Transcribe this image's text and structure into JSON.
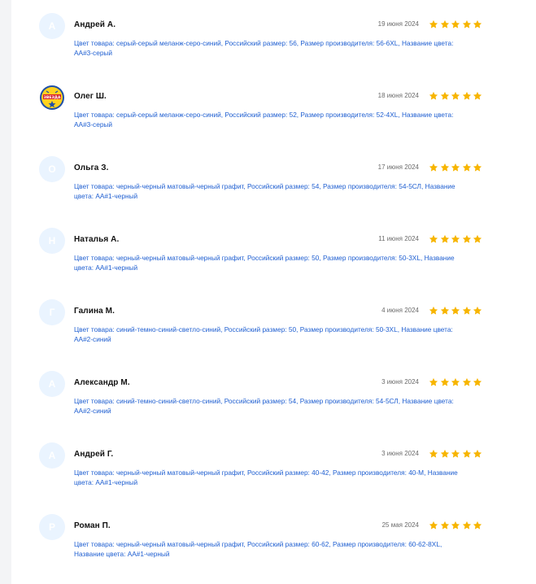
{
  "colors": {
    "star": "#f7b500",
    "details_text": "#1f5fd1",
    "avatar_bg": "#eaf4ff"
  },
  "reviews": [
    {
      "initial": "А",
      "avatar_type": "initial",
      "name": "Андрей А.",
      "date": "19 июня 2024",
      "rating": 5,
      "details": "Цвет товара: серый-серый меланж-серо-синий, Российский размер: 56, Размер производителя: 56-6XL, Название цвета: АА#3-серый"
    },
    {
      "initial": "",
      "avatar_type": "photo",
      "avatar_icon": "team-logo-icon",
      "avatar_text": "ЗВЕЗДА",
      "name": "Олег Ш.",
      "date": "18 июня 2024",
      "rating": 5,
      "details": "Цвет товара: серый-серый меланж-серо-синий, Российский размер: 52, Размер производителя: 52-4XL, Название цвета: АА#3-серый"
    },
    {
      "initial": "О",
      "avatar_type": "initial",
      "name": "Ольга З.",
      "date": "17 июня 2024",
      "rating": 5,
      "details": "Цвет товара: черный-черный матовый-черный графит, Российский размер: 54, Размер производителя: 54-5СЛ, Название цвета: АА#1-черный"
    },
    {
      "initial": "Н",
      "avatar_type": "initial",
      "name": "Наталья А.",
      "date": "11 июня 2024",
      "rating": 5,
      "details": "Цвет товара: черный-черный матовый-черный графит, Российский размер: 50, Размер производителя: 50-3XL, Название цвета: АА#1-черный"
    },
    {
      "initial": "Г",
      "avatar_type": "initial",
      "name": "Галина М.",
      "date": "4 июня 2024",
      "rating": 5,
      "details": "Цвет товара: синий-темно-синий-светло-синий, Российский размер: 50, Размер производителя: 50-3XL, Название цвета: АА#2-синий"
    },
    {
      "initial": "А",
      "avatar_type": "initial",
      "name": "Александр М.",
      "date": "3 июня 2024",
      "rating": 5,
      "details": "Цвет товара: синий-темно-синий-светло-синий, Российский размер: 54, Размер производителя: 54-5СЛ, Название цвета: АА#2-синий"
    },
    {
      "initial": "А",
      "avatar_type": "initial",
      "name": "Андрей Г.",
      "date": "3 июня 2024",
      "rating": 5,
      "details": "Цвет товара: черный-черный матовый-черный графит, Российский размер: 40-42, Размер производителя: 40-М, Название цвета: АА#1-черный"
    },
    {
      "initial": "Р",
      "avatar_type": "initial",
      "name": "Роман П.",
      "date": "25 мая 2024",
      "rating": 5,
      "details": "Цвет товара: черный-черный матовый-черный графит, Российский размер: 60-62, Размер производителя: 60-62-8XL, Название цвета: АА#1-черный"
    }
  ]
}
